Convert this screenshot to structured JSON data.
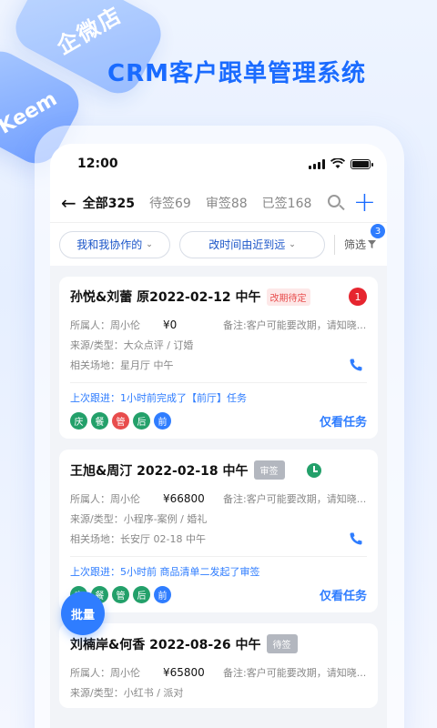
{
  "promo": {
    "title": "CRM客户跟单管理系统",
    "deco_text_1": "企微店",
    "deco_text_2": "Keem"
  },
  "statusbar": {
    "time": "12:00"
  },
  "tabs": [
    {
      "label": "全部325",
      "active": true
    },
    {
      "label": "待签69",
      "active": false
    },
    {
      "label": "审签88",
      "active": false
    },
    {
      "label": "已签168",
      "active": false
    }
  ],
  "filters": {
    "scope": "我和我协作的",
    "sort": "改时间由近到远",
    "filter_label": "筛选",
    "filter_count": "3"
  },
  "cards": [
    {
      "title": "孙悦&刘蕾 原2022-02-12 中午",
      "tag": "改期待定",
      "badge": "1",
      "owner": "所属人：周小伦",
      "amount": "¥0",
      "note": "备注:客户可能要改期，请知晓...",
      "source": "来源/类型：大众点评 / 订婚",
      "venue": "相关场地：星月厅  中午",
      "last_follow": "上次跟进：1小时前完成了【前厅】任务",
      "steps": [
        {
          "label": "庆",
          "color": "#23a06a"
        },
        {
          "label": "餐",
          "color": "#23a06a"
        },
        {
          "label": "管",
          "color": "#e84d4d"
        },
        {
          "label": "后",
          "color": "#23a06a"
        },
        {
          "label": "前",
          "color": "#2f7dff"
        }
      ],
      "action": "仅看任务"
    },
    {
      "title": "王旭&周汀  2022-02-18  中午",
      "tag": "审签",
      "owner": "所属人：周小伦",
      "amount": "¥66800",
      "note": "备注:客户可能要改期，请知晓...",
      "source": "来源/类型：小程序-案例 / 婚礼",
      "venue": "相关场地：长安厅 02-18 中午",
      "last_follow": "上次跟进：5小时前 商品清单二发起了审签",
      "steps": [
        {
          "label": "庆",
          "color": "#23a06a"
        },
        {
          "label": "餐",
          "color": "#23a06a"
        },
        {
          "label": "管",
          "color": "#23a06a"
        },
        {
          "label": "后",
          "color": "#23a06a"
        },
        {
          "label": "前",
          "color": "#2f7dff"
        }
      ],
      "action": "仅看任务"
    },
    {
      "title": "刘楠岸&何香  2022-08-26  中午",
      "tag": "待签",
      "owner": "所属人：周小伦",
      "amount": "¥65800",
      "note": "备注:客户可能要改期，请知晓...",
      "source": "来源/类型：小红书 / 派对"
    }
  ],
  "batch_button": "批量"
}
